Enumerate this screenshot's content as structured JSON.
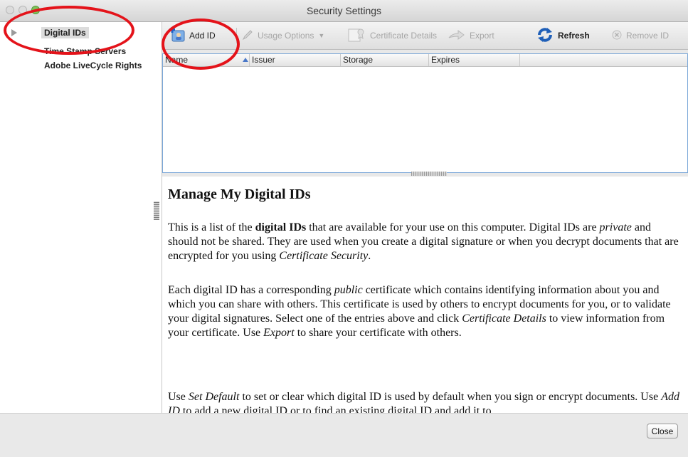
{
  "window": {
    "title": "Security Settings"
  },
  "sidebar": {
    "items": [
      {
        "label": "Digital IDs"
      },
      {
        "label": "Time Stamp Servers"
      },
      {
        "label": "Adobe LiveCycle Rights"
      }
    ]
  },
  "toolbar": {
    "add_id": "Add ID",
    "usage_options": "Usage Options",
    "certificate_details": "Certificate Details",
    "export": "Export",
    "refresh": "Refresh",
    "remove_id": "Remove ID"
  },
  "table": {
    "columns": [
      "Name",
      "Issuer",
      "Storage",
      "Expires"
    ]
  },
  "content": {
    "heading": "Manage My Digital IDs",
    "p1": [
      {
        "t": "This is a list of the "
      },
      {
        "t": "digital IDs",
        "b": true
      },
      {
        "t": " that are available for your use on this computer. Digital IDs are "
      },
      {
        "t": "private",
        "i": true
      },
      {
        "t": " and should not be shared. They are used when you create a digital signature or when you decrypt documents that are encrypted for you using "
      },
      {
        "t": "Certificate Security",
        "i": true
      },
      {
        "t": "."
      }
    ],
    "p2": [
      {
        "t": "Each digital ID has a corresponding "
      },
      {
        "t": "public",
        "i": true
      },
      {
        "t": " certificate which contains identifying information about you and which you can share with others. This certificate is used by others to encrypt documents for you, or to validate your digital signatures. Select one of the entries above and click "
      },
      {
        "t": "Certificate Details",
        "i": true
      },
      {
        "t": " to view information from your certificate. Use "
      },
      {
        "t": "Export",
        "i": true
      },
      {
        "t": " to share your certificate with others."
      }
    ],
    "p3": [
      {
        "t": "Use "
      },
      {
        "t": "Set Default",
        "i": true
      },
      {
        "t": " to set or clear which digital ID is used by default when you sign or encrypt documents. Use "
      },
      {
        "t": "Add ID",
        "i": true
      },
      {
        "t": " to add a new digital ID or to find an existing digital ID and add it to"
      }
    ]
  },
  "footer": {
    "close": "Close"
  },
  "colors": {
    "annotation": "#e4131a",
    "accent": "#2a6fd0"
  },
  "icons": [
    "disclosure-triangle-icon",
    "add-id-icon",
    "pencil-icon",
    "certificate-icon",
    "export-arrow-icon",
    "refresh-icon",
    "remove-icon",
    "sort-arrow-icon"
  ]
}
